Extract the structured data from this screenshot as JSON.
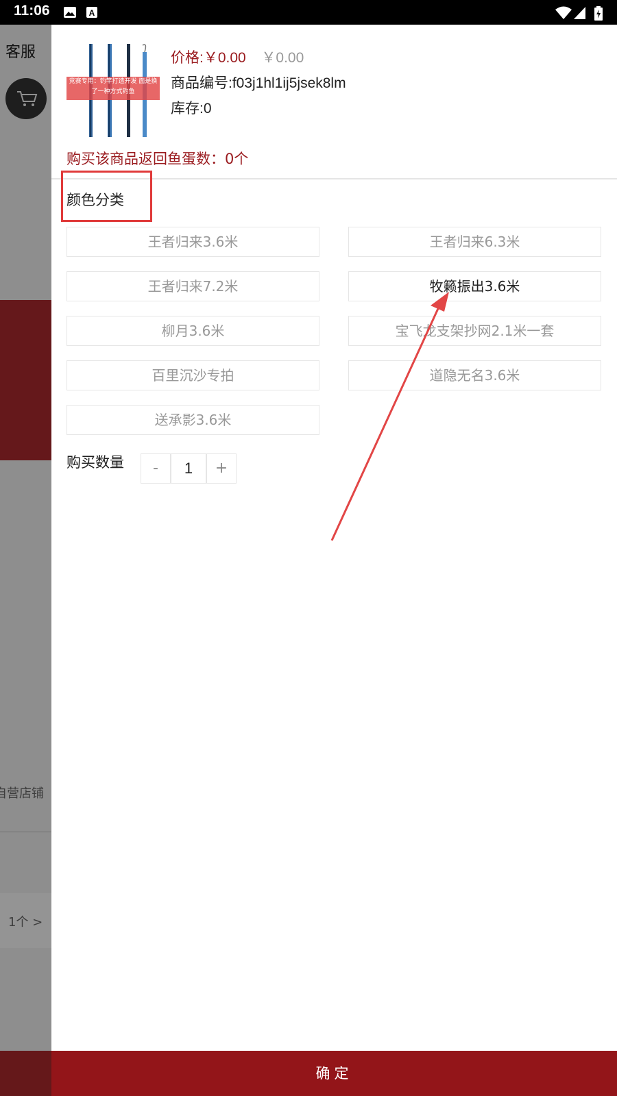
{
  "status_bar": {
    "time": "11:06",
    "icons": [
      "image-icon",
      "a-icon",
      "wifi-icon",
      "signal-icon",
      "battery-icon"
    ]
  },
  "background_page": {
    "service_label": "客服",
    "shop_label": "自营店铺",
    "count_label": "1个 >"
  },
  "product": {
    "image_caption": "竞赛专用：钓竿打造开发 面是换了一种方式钓鱼",
    "price": "价格:￥0.00",
    "original_price": "￥0.00",
    "sku": "商品编号:f03j1hl1ij5jsek8lm",
    "stock": "库存:0",
    "rebate": "购买该商品返回鱼蛋数：0个"
  },
  "spec": {
    "title": "颜色分类",
    "selected": "牧籁振出3.6米",
    "options": [
      "王者归来3.6米",
      "王者归来6.3米",
      "王者归来7.2米",
      "牧籁振出3.6米",
      "柳月3.6米",
      "宝飞龙支架抄网2.1米一套",
      "百里沉沙专拍",
      "道隐无名3.6米",
      "送承影3.6米"
    ]
  },
  "quantity": {
    "label": "购买数量",
    "minus": "-",
    "value": "1",
    "plus": "+"
  },
  "confirm_button": "确定",
  "colors": {
    "accent_red": "#931519",
    "price_red": "#9a1b1f",
    "highlight_red": "#e03a3a"
  }
}
